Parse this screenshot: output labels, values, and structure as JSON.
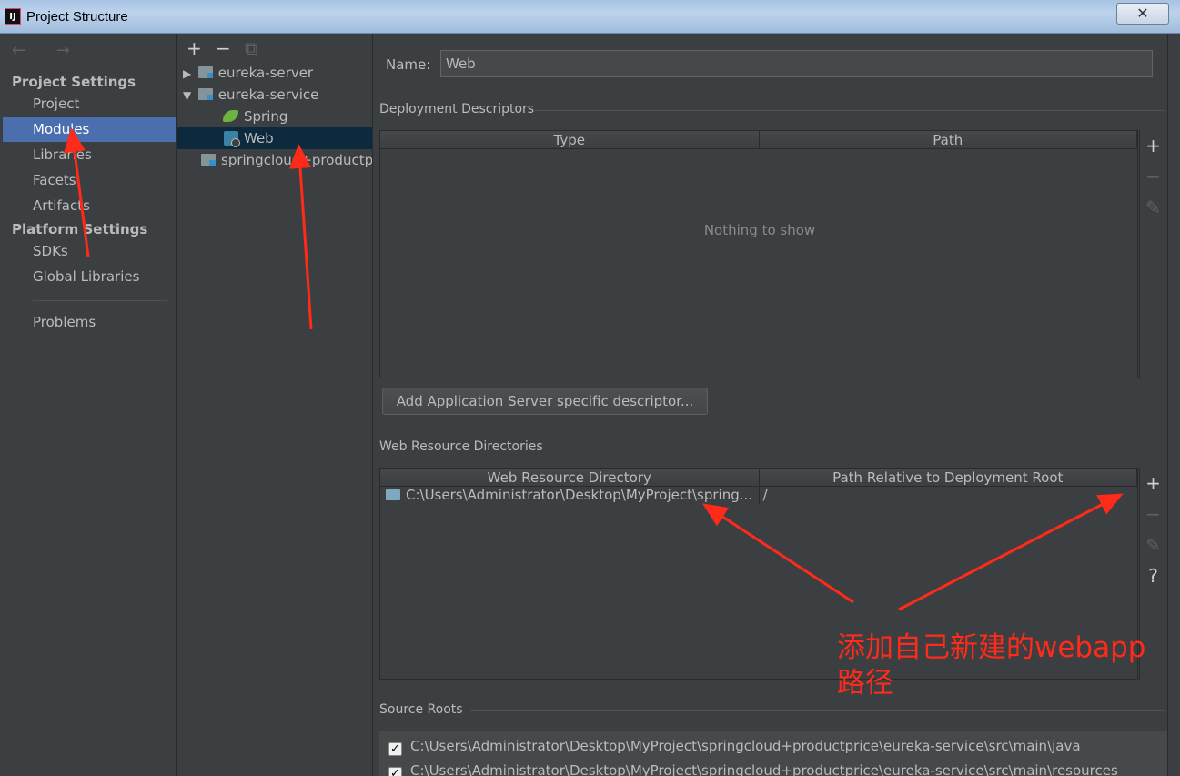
{
  "window": {
    "title": "Project Structure",
    "app_icon": "IJ",
    "close_glyph": "✕"
  },
  "nav": {
    "back_forward": "← →",
    "project_settings_heading": "Project Settings",
    "platform_settings_heading": "Platform Settings",
    "items": {
      "project": "Project",
      "modules": "Modules",
      "libraries": "Libraries",
      "facets": "Facets",
      "artifacts": "Artifacts",
      "sdks": "SDKs",
      "global_libraries": "Global Libraries",
      "problems": "Problems"
    },
    "selected": "Modules"
  },
  "tree": {
    "toolbar": {
      "add": "+",
      "remove": "−",
      "copy": "⧉"
    },
    "rows": {
      "eureka_server": "eureka-server",
      "eureka_service": "eureka-service",
      "spring": "Spring",
      "web": "Web",
      "springcloud": "springcloud+productp"
    },
    "selected": "Web"
  },
  "facet": {
    "name_label": "Name:",
    "name_value": "Web",
    "deployment_descriptors": {
      "title": "Deployment Descriptors",
      "columns": [
        "Type",
        "Path"
      ],
      "empty_text": "Nothing to show",
      "toolbar": {
        "add": "+",
        "remove": "−",
        "edit": "✎"
      }
    },
    "add_descriptor_button": "Add Application Server specific descriptor...",
    "web_resource_directories": {
      "title": "Web Resource Directories",
      "columns": [
        "Web Resource Directory",
        "Path Relative to Deployment Root"
      ],
      "rows": [
        {
          "directory": "C:\\Users\\Administrator\\Desktop\\MyProject\\spring...",
          "path": "/"
        }
      ],
      "toolbar": {
        "add": "+",
        "remove": "−",
        "edit": "✎",
        "help": "?"
      }
    },
    "source_roots": {
      "title": "Source Roots",
      "rows": [
        {
          "checked": true,
          "path": "C:\\Users\\Administrator\\Desktop\\MyProject\\springcloud+productprice\\eureka-service\\src\\main\\java"
        },
        {
          "checked": true,
          "path": "C:\\Users\\Administrator\\Desktop\\MyProject\\springcloud+productprice\\eureka-service\\src\\main\\resources"
        }
      ]
    }
  },
  "annotation": {
    "line1": "添加自己新建的webapp",
    "line2": "路径",
    "color": "#ff2a1a"
  },
  "colors": {
    "background": "#3c3f41",
    "selection": "#4b6eaf",
    "tree_selection": "#0d293e",
    "text": "#bbbbbb"
  }
}
